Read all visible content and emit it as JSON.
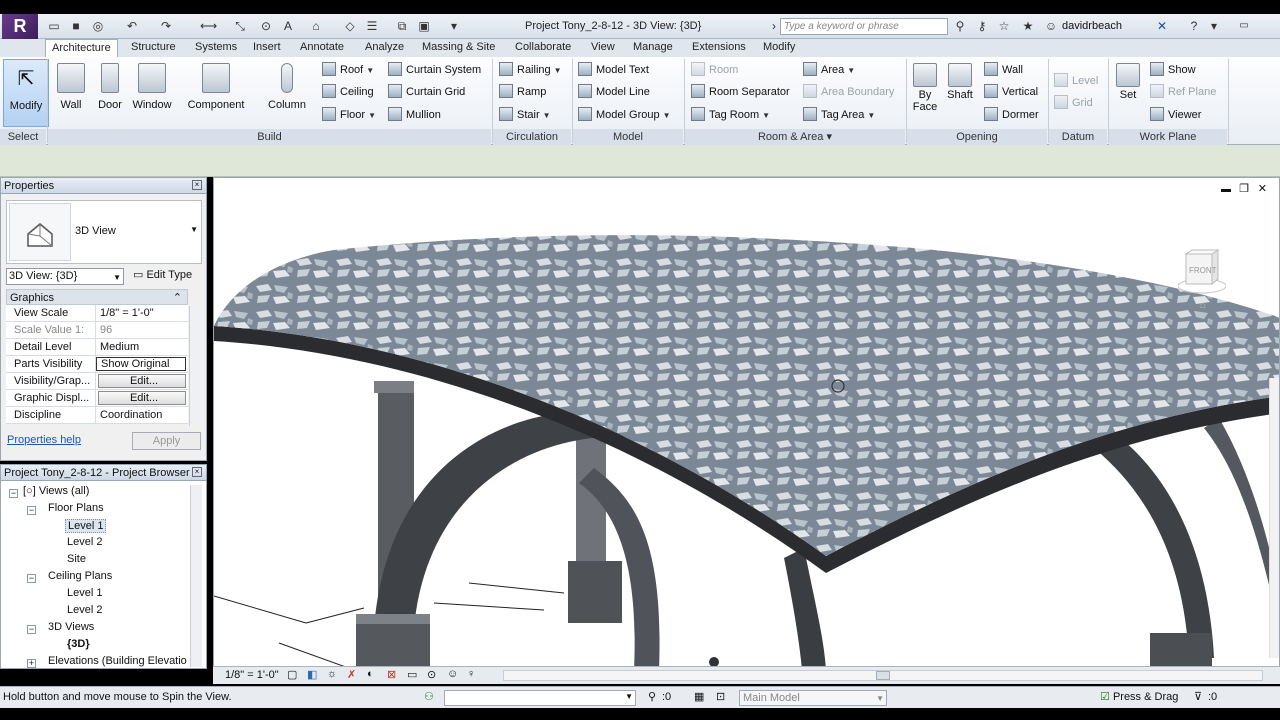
{
  "app": {
    "logo_letter": "R",
    "document_title": "Project Tony_2-8-12 - 3D View: {3D}",
    "search_placeholder": "Type a keyword or phrase",
    "user_name": "davidrbeach"
  },
  "tabs": [
    {
      "label": "Architecture",
      "active": true
    },
    {
      "label": "Structure"
    },
    {
      "label": "Systems"
    },
    {
      "label": "Insert"
    },
    {
      "label": "Annotate"
    },
    {
      "label": "Analyze"
    },
    {
      "label": "Massing & Site"
    },
    {
      "label": "Collaborate"
    },
    {
      "label": "View"
    },
    {
      "label": "Manage"
    },
    {
      "label": "Extensions"
    },
    {
      "label": "Modify"
    }
  ],
  "ribbon": {
    "select": {
      "title": "Select",
      "modify": "Modify"
    },
    "build": {
      "title": "Build",
      "wall": "Wall",
      "door": "Door",
      "window": "Window",
      "component": "Component",
      "column": "Column",
      "roof": "Roof",
      "ceiling": "Ceiling",
      "floor": "Floor",
      "curtain_system": "Curtain System",
      "curtain_grid": "Curtain Grid",
      "mullion": "Mullion"
    },
    "circulation": {
      "title": "Circulation",
      "railing": "Railing",
      "ramp": "Ramp",
      "stair": "Stair"
    },
    "model": {
      "title": "Model",
      "model_text": "Model Text",
      "model_line": "Model Line",
      "model_group": "Model Group"
    },
    "room_area": {
      "title": "Room & Area",
      "room": "Room",
      "room_separator": "Room Separator",
      "tag_room": "Tag Room",
      "area": "Area",
      "area_boundary": "Area Boundary",
      "tag_area": "Tag Area"
    },
    "opening": {
      "title": "Opening",
      "by_face": "By Face",
      "by_face_line2": "Face",
      "by_face_line1": "By",
      "shaft": "Shaft",
      "wall": "Wall",
      "vertical": "Vertical",
      "dormer": "Dormer"
    },
    "datum": {
      "title": "Datum",
      "level": "Level",
      "grid": "Grid"
    },
    "work_plane": {
      "title": "Work Plane",
      "set": "Set",
      "show": "Show",
      "ref_plane": "Ref Plane",
      "viewer": "Viewer"
    }
  },
  "properties": {
    "title": "Properties",
    "type_name": "3D View",
    "view_selector": "3D View: {3D}",
    "edit_type": "Edit Type",
    "group": "Graphics",
    "rows": [
      {
        "k": "View Scale",
        "v": "1/8\" = 1'-0\""
      },
      {
        "k": "Scale Value    1:",
        "v": "96",
        "dim": true
      },
      {
        "k": "Detail Level",
        "v": "Medium"
      },
      {
        "k": "Parts Visibility",
        "v": "Show Original",
        "boxed": true
      },
      {
        "k": "Visibility/Grap...",
        "v": "Edit...",
        "btn": true
      },
      {
        "k": "Graphic Displ...",
        "v": "Edit...",
        "btn": true
      },
      {
        "k": "Discipline",
        "v": "Coordination"
      }
    ],
    "help": "Properties help",
    "apply": "Apply"
  },
  "browser": {
    "title": "Project Tony_2-8-12 - Project Browser",
    "items": [
      {
        "label": "Views (all)"
      },
      {
        "label": "Floor Plans"
      },
      {
        "label": "Level 1"
      },
      {
        "label": "Level 2"
      },
      {
        "label": "Site"
      },
      {
        "label": "Ceiling Plans"
      },
      {
        "label": "Level 1"
      },
      {
        "label": "Level 2"
      },
      {
        "label": "3D Views"
      },
      {
        "label": "{3D}"
      },
      {
        "label": "Elevations (Building Elevatio"
      }
    ]
  },
  "viewport": {
    "viewcube_label": "FRONT"
  },
  "viewbar": {
    "scale": "1/8\" = 1'-0\""
  },
  "status": {
    "text": "Hold button and move mouse to Spin the View.",
    "workset_count": ":0",
    "model": "Main Model",
    "press_drag": "Press & Drag",
    "filter_count": ":0"
  }
}
